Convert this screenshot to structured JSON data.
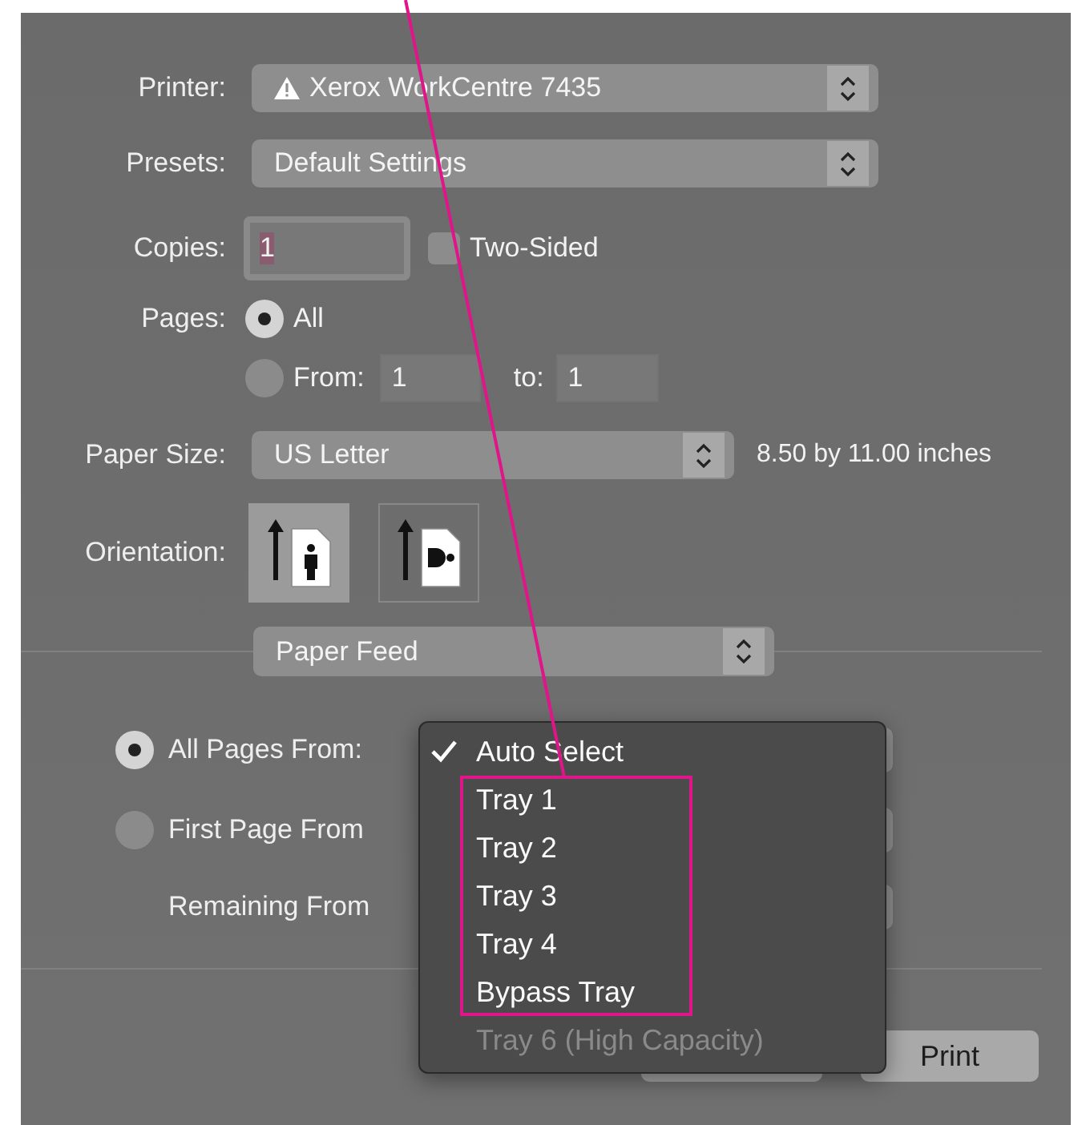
{
  "printer": {
    "label": "Printer:",
    "value": "Xerox WorkCentre 7435",
    "warning": true
  },
  "presets": {
    "label": "Presets:",
    "value": "Default Settings"
  },
  "copies": {
    "label": "Copies:",
    "value": "1",
    "focused": true
  },
  "two_sided": {
    "label": "Two-Sided",
    "checked": false
  },
  "pages": {
    "label": "Pages:",
    "options": [
      {
        "label": "All",
        "selected": true
      },
      {
        "label": "From:",
        "selected": false
      }
    ],
    "from": "1",
    "to_label": "to:",
    "to": "1"
  },
  "paper_size": {
    "label": "Paper Size:",
    "value": "US Letter",
    "dimensions": "8.50 by 11.00 inches"
  },
  "orientation": {
    "label": "Orientation:",
    "options": [
      {
        "kind": "portrait",
        "selected": true
      },
      {
        "kind": "landscape",
        "selected": false
      }
    ]
  },
  "section": {
    "value": "Paper Feed"
  },
  "paper_feed": [
    {
      "label": "All Pages From:",
      "kind": "radio",
      "selected": true
    },
    {
      "label": "First Page From",
      "kind": "radio",
      "selected": false
    },
    {
      "label": "Remaining From",
      "kind": "plain"
    }
  ],
  "menu": {
    "items": [
      {
        "label": "Auto Select",
        "kind": "checked",
        "highlighted": false
      },
      {
        "label": "Tray 1",
        "kind": "option",
        "highlighted": true
      },
      {
        "label": "Tray 2",
        "kind": "option",
        "highlighted": true
      },
      {
        "label": "Tray 3",
        "kind": "option",
        "highlighted": true
      },
      {
        "label": "Tray 4",
        "kind": "option",
        "highlighted": true
      },
      {
        "label": "Bypass Tray",
        "kind": "option",
        "highlighted": true
      },
      {
        "label": "Tray 6 (High Capacity)",
        "kind": "disabled",
        "highlighted": false
      }
    ]
  },
  "buttons": [
    {
      "label": "Print"
    }
  ],
  "callout": {
    "kind": "line"
  }
}
